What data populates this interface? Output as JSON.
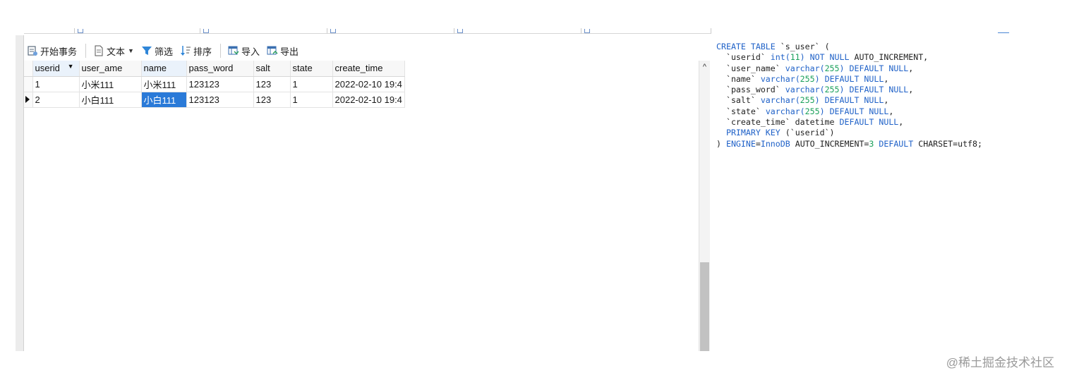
{
  "toolbar": {
    "begin_transaction": "开始事务",
    "text": "文本",
    "filter": "筛选",
    "sort": "排序",
    "import": "导入",
    "export": "导出"
  },
  "grid": {
    "columns": [
      "userid",
      "user_ame",
      "name",
      "pass_word",
      "salt",
      "state",
      "create_time"
    ],
    "rows": [
      {
        "userid": "1",
        "user_ame": "小米111",
        "name": "小米111",
        "pass_word": "123123",
        "salt": "123",
        "state": "1",
        "create_time": "2022-02-10 19:4"
      },
      {
        "userid": "2",
        "user_ame": "小白111",
        "name": "小白111",
        "pass_word": "123123",
        "salt": "123",
        "state": "1",
        "create_time": "2022-02-10 19:4"
      }
    ],
    "selected_cell": {
      "row": 2,
      "column": "name"
    },
    "sorted_column": "userid"
  },
  "ddl": {
    "line1_kw": "CREATE TABLE",
    "line1_rest": " `s_user` (",
    "l2a": "  `userid` ",
    "l2b": "int(",
    "l2c": "11",
    "l2d": ") ",
    "l2e": "NOT NULL",
    "l2f": " AUTO_INCREMENT,",
    "l3a": "  `user_name` ",
    "l3b": "varchar(",
    "l3c": "255",
    "l3d": ") ",
    "l3e": "DEFAULT NULL",
    "l3f": ",",
    "l4a": "  `name` ",
    "l4b": "varchar(",
    "l4c": "255",
    "l4d": ") ",
    "l4e": "DEFAULT NULL",
    "l4f": ",",
    "l5a": "  `pass_word` ",
    "l5b": "varchar(",
    "l5c": "255",
    "l5d": ") ",
    "l5e": "DEFAULT NULL",
    "l5f": ",",
    "l6a": "  `salt` ",
    "l6b": "varchar(",
    "l6c": "255",
    "l6d": ") ",
    "l6e": "DEFAULT NULL",
    "l6f": ",",
    "l7a": "  `state` ",
    "l7b": "varchar(",
    "l7c": "255",
    "l7d": ") ",
    "l7e": "DEFAULT NULL",
    "l7f": ",",
    "l8a": "  `create_time` datetime ",
    "l8e": "DEFAULT NULL",
    "l8f": ",",
    "l9a": "  ",
    "l9kw": "PRIMARY KEY",
    "l9b": " (`userid`)",
    "l10a": ") ",
    "l10kw1": "ENGINE",
    "l10b": "=",
    "l10kw2": "InnoDB",
    "l10c": " AUTO_INCREMENT=",
    "l10n": "3",
    "l10d": " ",
    "l10kw3": "DEFAULT",
    "l10e": " CHARSET=utf8;"
  },
  "watermark": "@稀土掘金技术社区",
  "colors": {
    "selection": "#2a7ad8",
    "keyword": "#2062c8",
    "number": "#1aa05a"
  }
}
